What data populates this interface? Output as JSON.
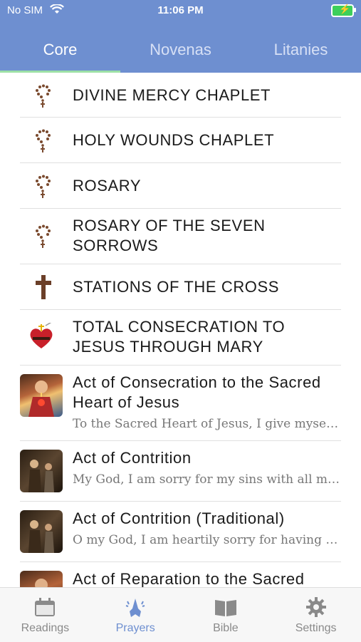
{
  "status_bar": {
    "carrier": "No SIM",
    "time": "11:06 PM"
  },
  "tabs": [
    {
      "label": "Core"
    },
    {
      "label": "Novenas"
    },
    {
      "label": "Litanies"
    }
  ],
  "items": [
    {
      "title": "DIVINE MERCY CHAPLET",
      "icon": "rosary-icon"
    },
    {
      "title": "HOLY WOUNDS CHAPLET",
      "icon": "rosary-icon"
    },
    {
      "title": "ROSARY",
      "icon": "rosary-icon"
    },
    {
      "title": "ROSARY OF THE SEVEN SORROWS",
      "icon": "rosary-icon"
    },
    {
      "title": "STATIONS OF THE CROSS",
      "icon": "cross-icon"
    },
    {
      "title": "TOTAL CONSECRATION TO JESUS THROUGH MARY",
      "icon": "sacred-heart-icon"
    },
    {
      "title": "Act of Consecration to the Sacred Heart of Jesus",
      "subtitle": "To the Sacred Heart of Jesus, I give myself, and consecrate to Thee",
      "icon": "sacred-heart-image"
    },
    {
      "title": "Act of Contrition",
      "subtitle": "My God, I am sorry for my sins with all my heart",
      "icon": "confession-image"
    },
    {
      "title": "Act of Contrition (Traditional)",
      "subtitle": "O my God, I am heartily sorry for having offended Thee",
      "icon": "confession-image"
    },
    {
      "title": "Act of Reparation to the Sacred",
      "icon": "sacred-heart-image"
    }
  ],
  "bottom_nav": [
    {
      "label": "Readings",
      "icon": "calendar-icon"
    },
    {
      "label": "Prayers",
      "icon": "praying-hands-icon"
    },
    {
      "label": "Bible",
      "icon": "book-icon"
    },
    {
      "label": "Settings",
      "icon": "gear-icon"
    }
  ],
  "colors": {
    "header": "#6e8fd0",
    "tab_indicator": "#9de0a6",
    "active_nav": "#6e8fd0"
  }
}
